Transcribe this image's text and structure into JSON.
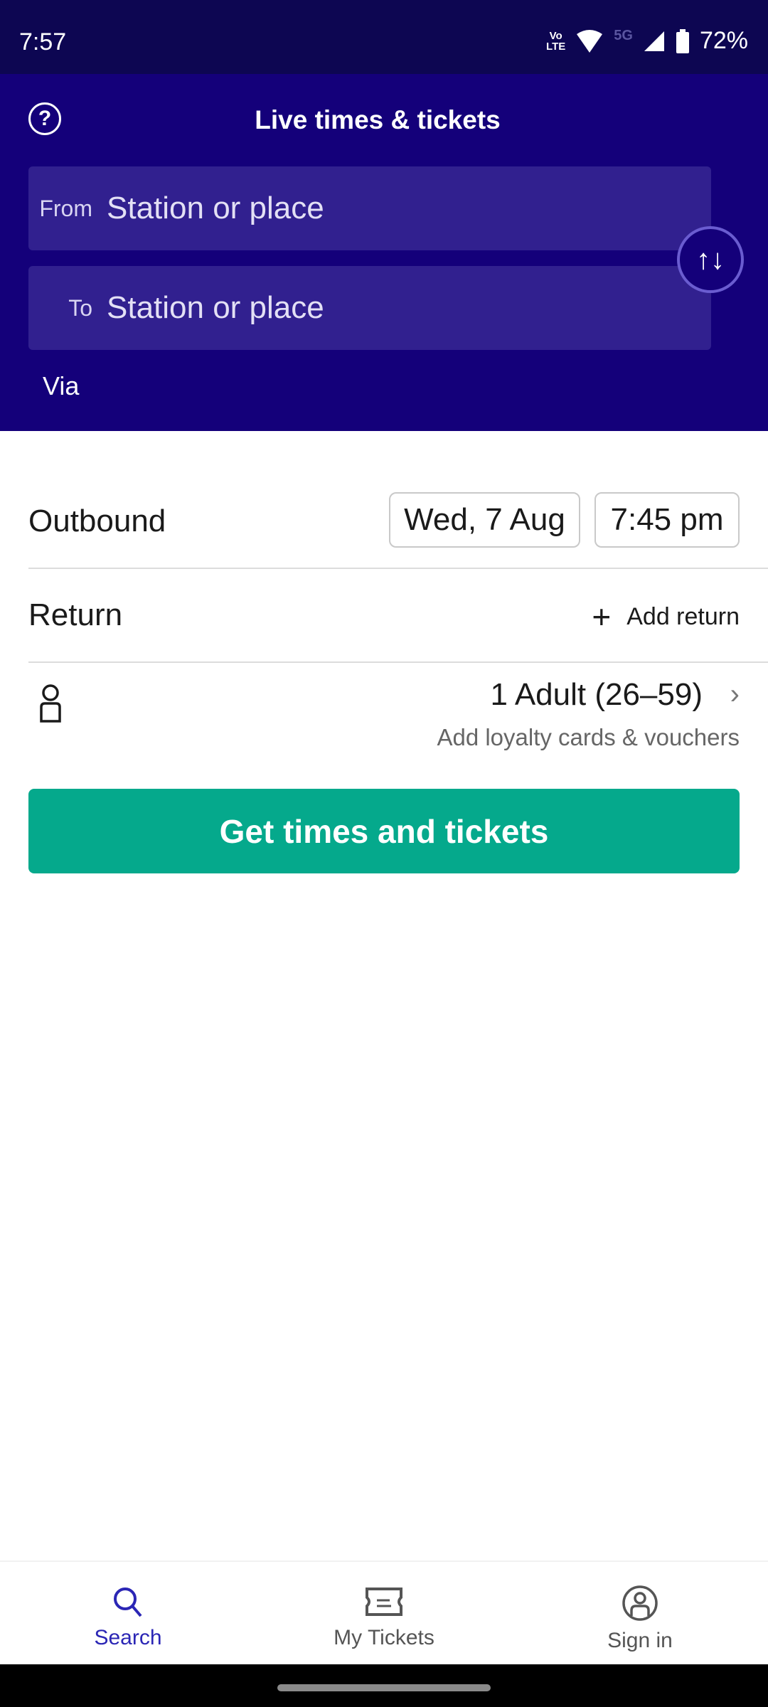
{
  "status_bar": {
    "time": "7:57",
    "volte": [
      "Vo",
      "LTE"
    ],
    "network": "5G",
    "battery": "72%",
    "icons": [
      "volte-icon",
      "wifi-icon",
      "signal-icon",
      "battery-icon"
    ]
  },
  "header": {
    "title": "Live times & tickets",
    "help_icon": "?",
    "from": {
      "label": "From",
      "placeholder": "Station or place"
    },
    "to": {
      "label": "To",
      "placeholder": "Station or place"
    },
    "swap_icon": "↑↓",
    "via_label": "Via"
  },
  "journey": {
    "outbound_label": "Outbound",
    "outbound_date": "Wed, 7 Aug",
    "outbound_time": "7:45 pm",
    "return_label": "Return",
    "add_return_icon": "+",
    "add_return_label": "Add return"
  },
  "passengers": {
    "summary": "1 Adult (26–59)",
    "chevron": "›",
    "sub": "Add loyalty cards & vouchers"
  },
  "cta": {
    "label": "Get times and tickets"
  },
  "bottom_nav": {
    "items": [
      {
        "label": "Search",
        "active": true
      },
      {
        "label": "My Tickets",
        "active": false
      },
      {
        "label": "Sign in",
        "active": false
      }
    ]
  },
  "colors": {
    "header": "#14007a",
    "status_bar": "#0d0652",
    "field": "#31208f",
    "cta": "#05a98c",
    "nav_active": "#2b26b5"
  }
}
